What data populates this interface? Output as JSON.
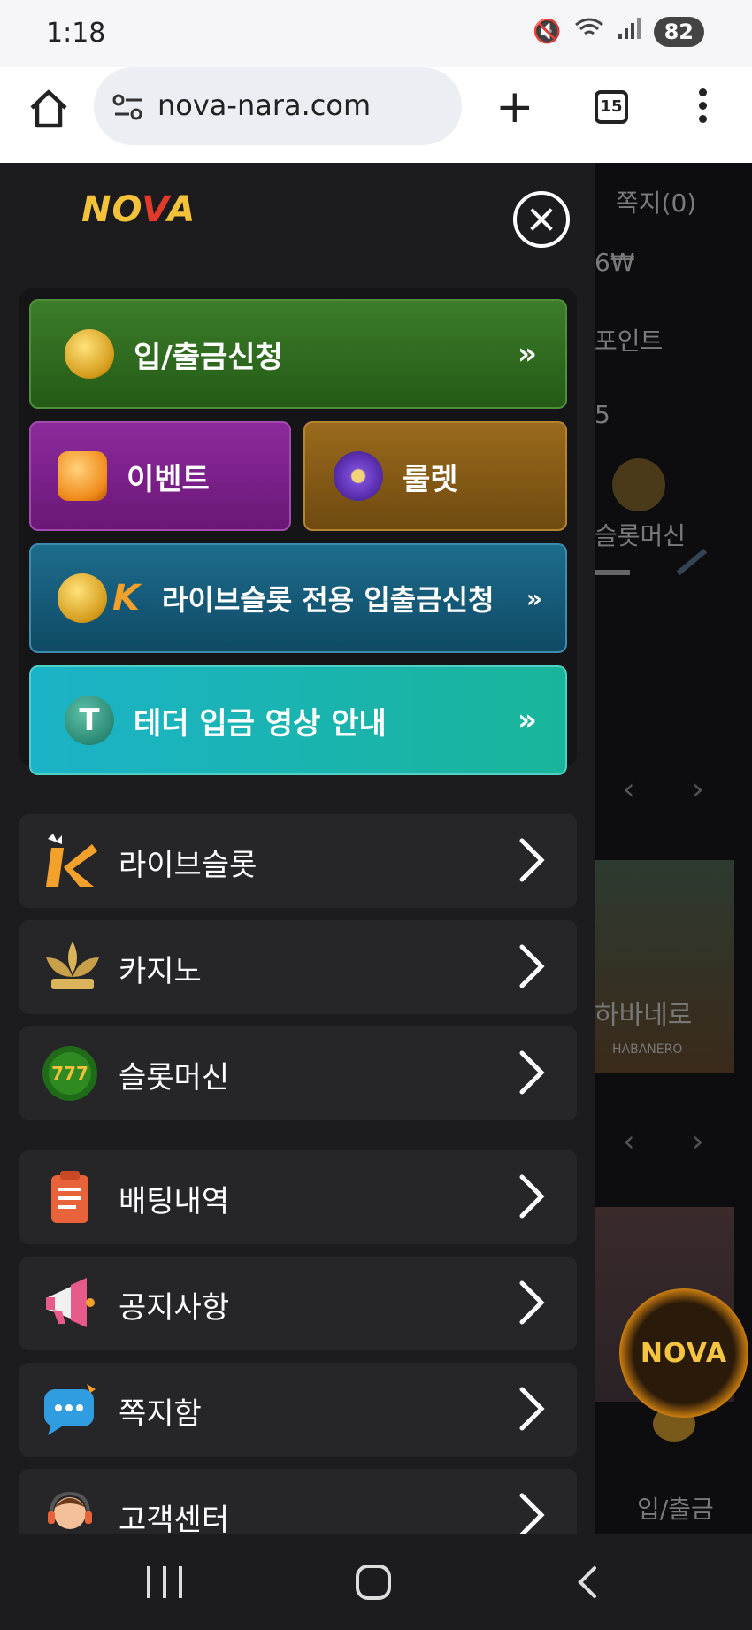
{
  "status_bar": {
    "time": "1:18",
    "battery": "82",
    "signal_label": "5"
  },
  "browser": {
    "url": "nova-nara.com",
    "tab_count": "15"
  },
  "drawer": {
    "logo": {
      "left": "NO",
      "middle": "V",
      "right": "A"
    },
    "quick": {
      "deposit": "입/출금신청",
      "deposit_chev": "»",
      "event": "이벤트",
      "roulette": "룰렛",
      "live_deposit": "라이브슬롯 전용 입출금신청",
      "live_chev": "»",
      "live_k": "K",
      "tether": "테더 입금 영상 안내",
      "tether_chev": "»",
      "tether_symbol": "T"
    },
    "menu": [
      {
        "label": "라이브슬롯",
        "icon": "k-logo-icon"
      },
      {
        "label": "카지노",
        "icon": "kslot-lotus-icon"
      },
      {
        "label": "슬롯머신",
        "icon": "777-slots-icon"
      },
      {
        "label": "배팅내역",
        "icon": "clipboard-icon"
      },
      {
        "label": "공지사항",
        "icon": "megaphone-icon"
      },
      {
        "label": "쪽지함",
        "icon": "chat-bubble-icon"
      },
      {
        "label": "고객센터",
        "icon": "support-agent-icon"
      }
    ]
  },
  "background_page": {
    "messages": "쪽지(0)",
    "balance_fragment": "6₩",
    "points_fragment": "포인트",
    "level_fragment": "5",
    "slot_tab_fragment": "슬롯머신",
    "game_title_fragment": "하바네로",
    "game_provider": "HABANERO",
    "bottom_tab": "입/출금",
    "fab_logo": "NOVA"
  },
  "colors": {
    "drawer_bg": "#1c1c1f",
    "deposit_green": "#3c7d2a",
    "event_purple": "#8c2a9c",
    "roulette_gold": "#9a6a1c",
    "live_blue": "#1d6c8c",
    "tether_teal": "#1bb3c8"
  }
}
